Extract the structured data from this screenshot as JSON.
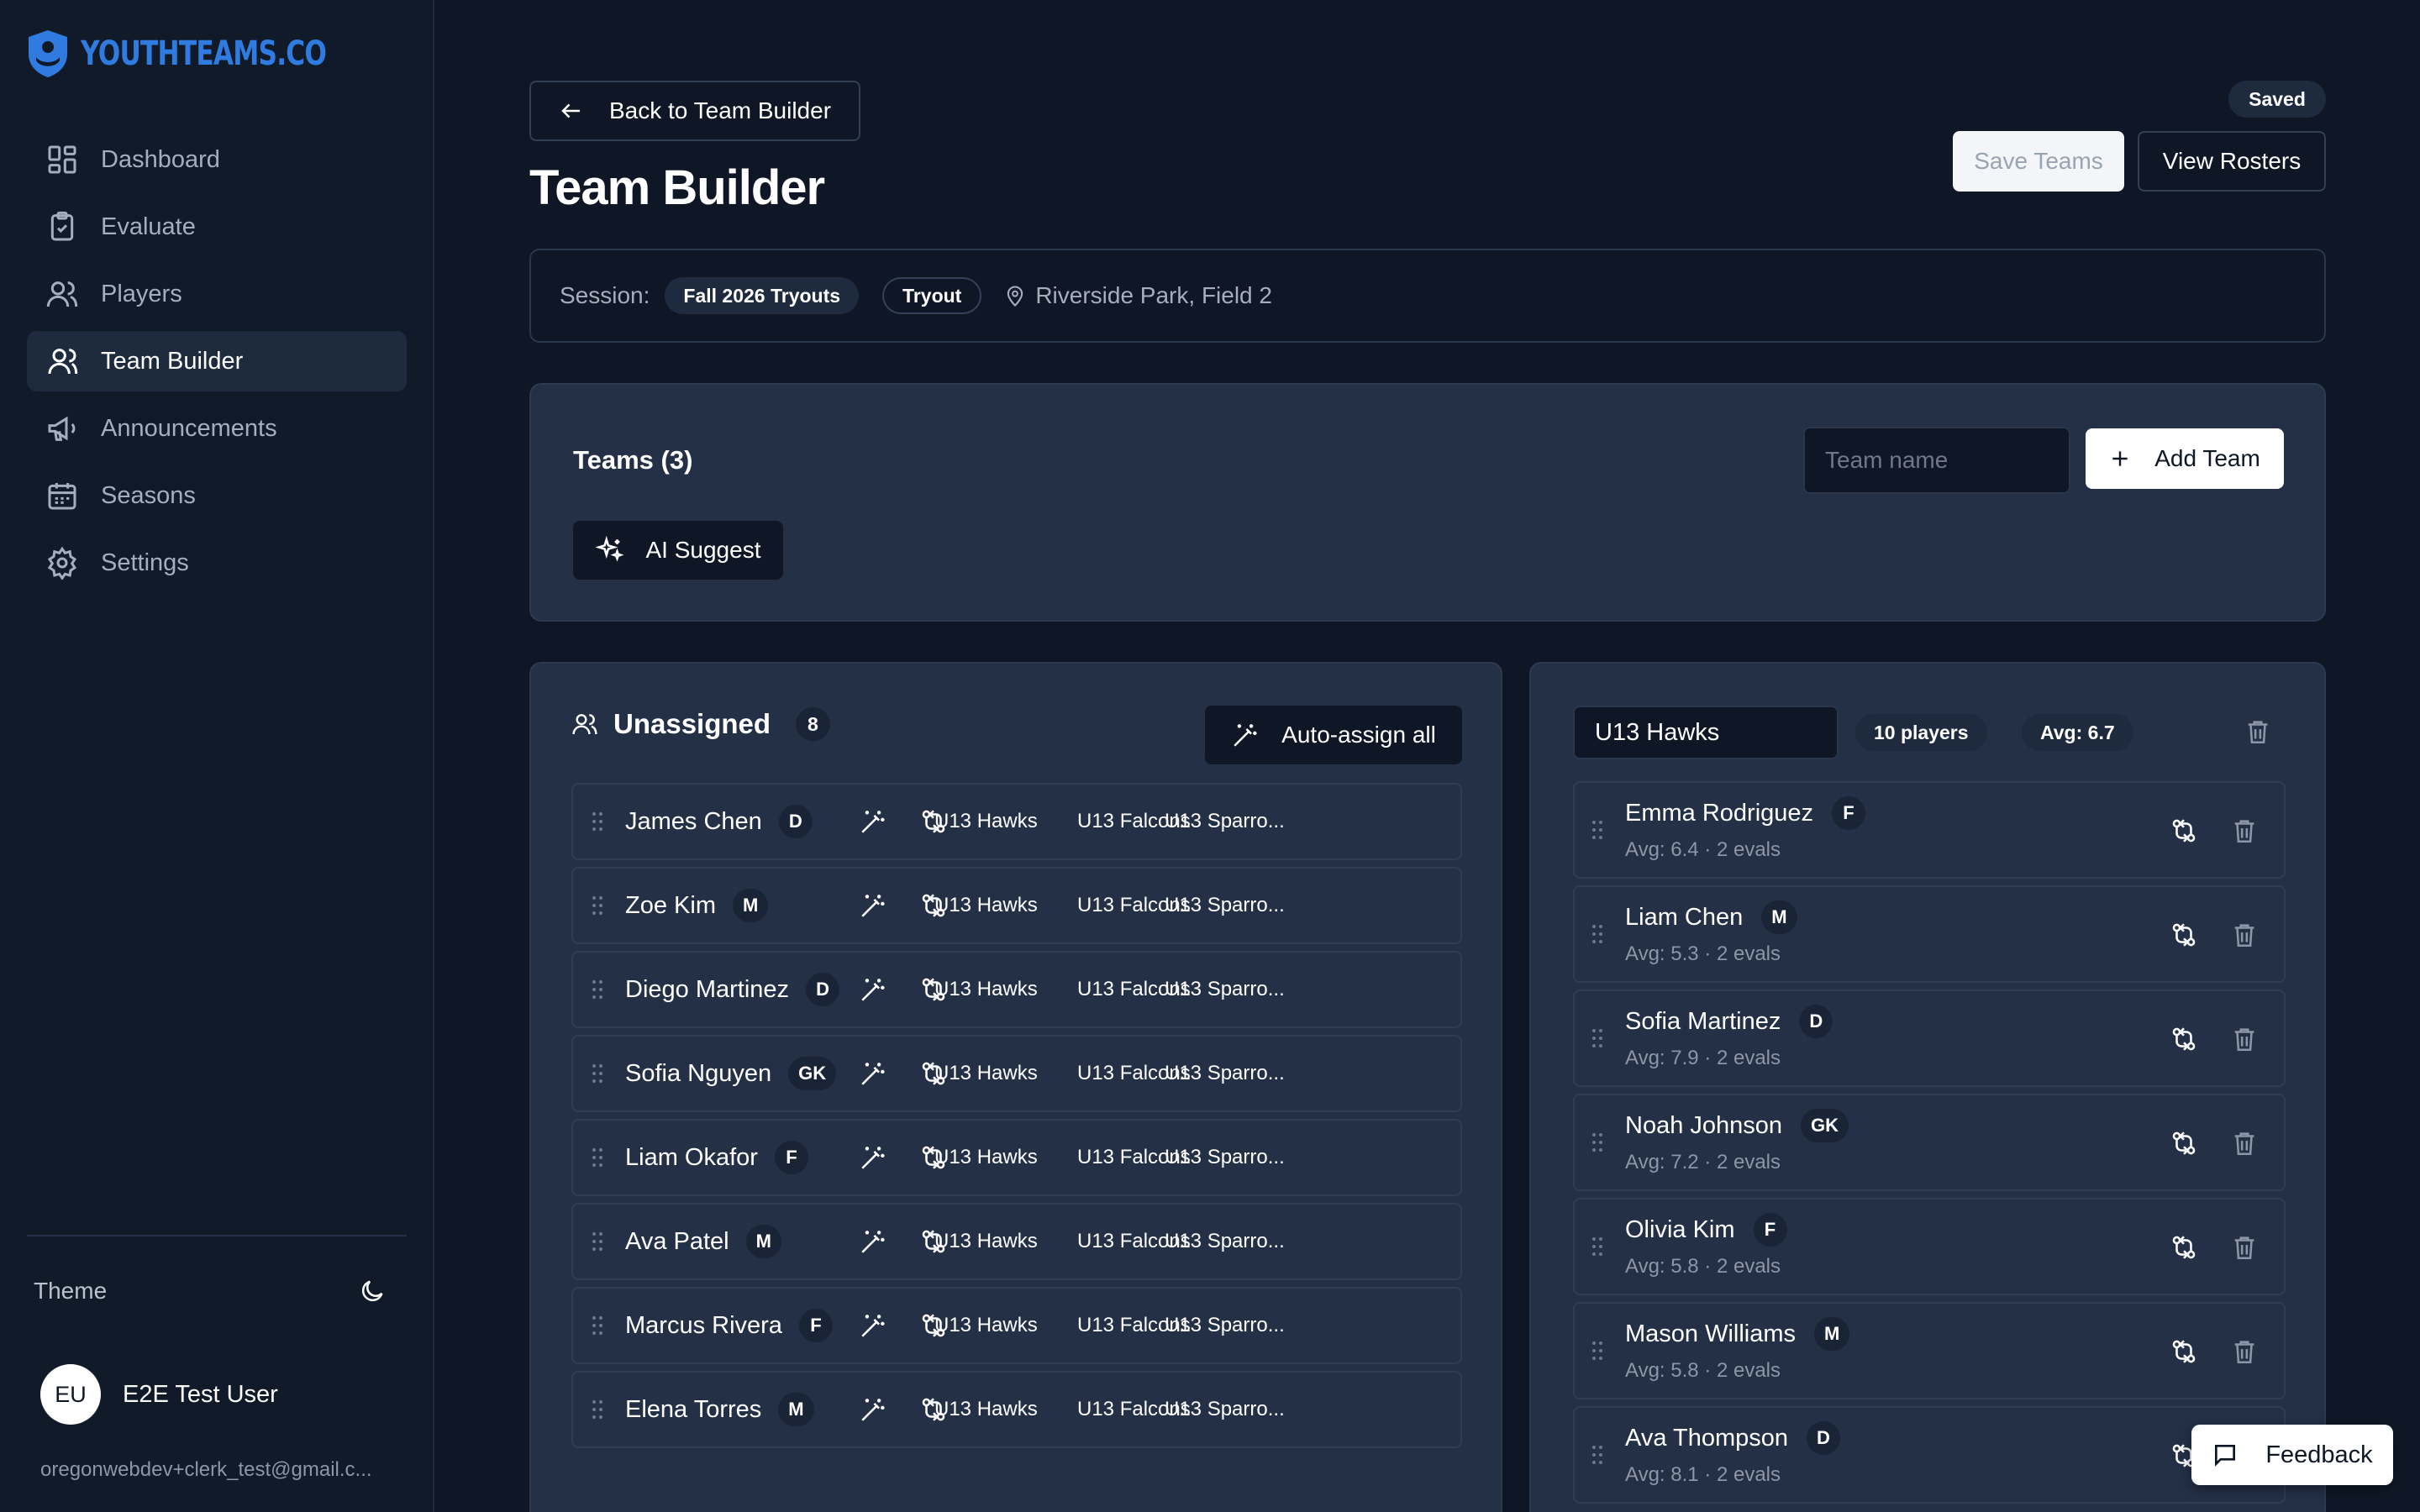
{
  "app": {
    "logo_text": "YOUTHTEAMS.CO",
    "accent": "#2f7be0"
  },
  "sidebar": {
    "items": [
      {
        "label": "Dashboard",
        "icon": "dashboard-icon"
      },
      {
        "label": "Evaluate",
        "icon": "clipboard-check-icon"
      },
      {
        "label": "Players",
        "icon": "users-icon"
      },
      {
        "label": "Team Builder",
        "icon": "user-icon",
        "active": true
      },
      {
        "label": "Announcements",
        "icon": "megaphone-icon"
      },
      {
        "label": "Seasons",
        "icon": "calendar-icon"
      },
      {
        "label": "Settings",
        "icon": "gear-icon"
      }
    ],
    "theme_label": "Theme",
    "user": {
      "initials": "EU",
      "name": "E2E Test User",
      "email": "oregonwebdev+clerk_test@gmail.c..."
    }
  },
  "header": {
    "back_label": "Back to Team Builder",
    "title": "Team Builder",
    "saved_badge": "Saved",
    "save_label": "Save Teams",
    "view_label": "View Rosters"
  },
  "session": {
    "label": "Session:",
    "name": "Fall 2026 Tryouts",
    "type": "Tryout",
    "location": "Riverside Park, Field 2"
  },
  "teams_panel": {
    "title": "Teams (3)",
    "name_placeholder": "Team name",
    "add_label": "Add Team",
    "ai_label": "AI Suggest"
  },
  "unassigned": {
    "title": "Unassigned",
    "count": "8",
    "autoassign_label": "Auto-assign all",
    "team_links": [
      "U13 Hawks",
      "U13 Falcons",
      "U13 Sparro..."
    ],
    "players": [
      {
        "name": "James Chen",
        "pos": "D"
      },
      {
        "name": "Zoe Kim",
        "pos": "M"
      },
      {
        "name": "Diego Martinez",
        "pos": "D"
      },
      {
        "name": "Sofia Nguyen",
        "pos": "GK"
      },
      {
        "name": "Liam Okafor",
        "pos": "F"
      },
      {
        "name": "Ava Patel",
        "pos": "M"
      },
      {
        "name": "Marcus Rivera",
        "pos": "F"
      },
      {
        "name": "Elena Torres",
        "pos": "M"
      }
    ]
  },
  "hawks": {
    "name": "U13 Hawks",
    "players_badge": "10 players",
    "avg_badge": "Avg: 6.7",
    "players": [
      {
        "name": "Emma Rodriguez",
        "pos": "F",
        "sub": "Avg: 6.4 · 2 evals"
      },
      {
        "name": "Liam Chen",
        "pos": "M",
        "sub": "Avg: 5.3 · 2 evals"
      },
      {
        "name": "Sofia Martinez",
        "pos": "D",
        "sub": "Avg: 7.9 · 2 evals"
      },
      {
        "name": "Noah Johnson",
        "pos": "GK",
        "sub": "Avg: 7.2 · 2 evals"
      },
      {
        "name": "Olivia Kim",
        "pos": "F",
        "sub": "Avg: 5.8 · 2 evals"
      },
      {
        "name": "Mason Williams",
        "pos": "M",
        "sub": "Avg: 5.8 · 2 evals"
      },
      {
        "name": "Ava Thompson",
        "pos": "D",
        "sub": "Avg: 8.1 · 2 evals"
      }
    ]
  },
  "feedback": {
    "label": "Feedback"
  }
}
